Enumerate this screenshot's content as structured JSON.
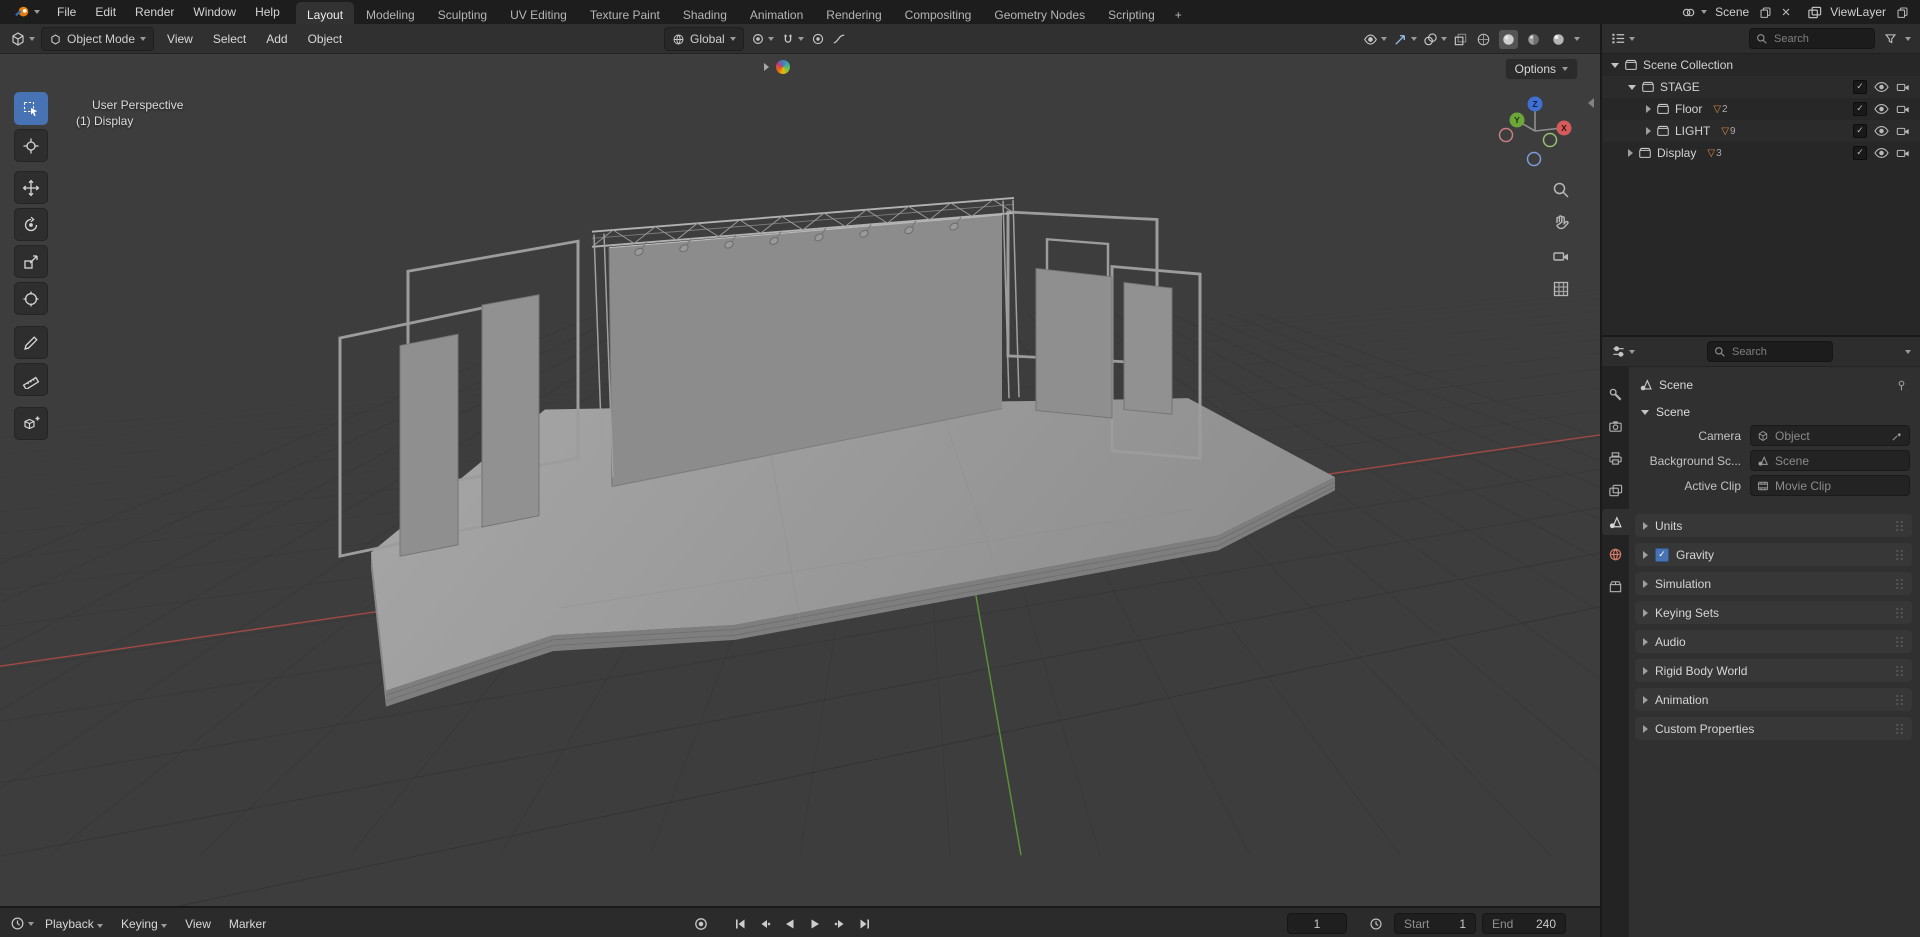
{
  "topbar": {
    "menus": [
      "File",
      "Edit",
      "Render",
      "Window",
      "Help"
    ],
    "tabs": [
      "Layout",
      "Modeling",
      "Sculpting",
      "UV Editing",
      "Texture Paint",
      "Shading",
      "Animation",
      "Rendering",
      "Compositing",
      "Geometry Nodes",
      "Scripting"
    ],
    "active_tab": "Layout",
    "new_workspace_label": "+",
    "scene_selector": {
      "value": "Scene"
    },
    "view_layer_selector": {
      "value": "ViewLayer"
    }
  },
  "viewport": {
    "header": {
      "mode": "Object Mode",
      "menus": [
        "View",
        "Select",
        "Add",
        "Object"
      ],
      "orientation": "Global"
    },
    "tool_header": {
      "options_label": "Options"
    },
    "overlay_text": {
      "line1": "User Perspective",
      "line2": "(1) Display"
    },
    "tools": [
      "Select Box",
      "Cursor",
      "Move",
      "Rotate",
      "Scale",
      "Transform",
      "Annotate",
      "Measure",
      "Add Cube"
    ],
    "axis_labels": {
      "x": "X",
      "y": "Y",
      "z": "Z"
    }
  },
  "outliner": {
    "search_placeholder": "Search",
    "badge_icon": "▽",
    "check_icon": "✓",
    "rows": [
      {
        "label": "Scene Collection"
      },
      {
        "label": "STAGE"
      },
      {
        "label": "Floor",
        "badge": "2"
      },
      {
        "label": "LIGHT",
        "badge": "9"
      },
      {
        "label": "Display",
        "badge": "3"
      }
    ]
  },
  "properties": {
    "search_placeholder": "Search",
    "breadcrumb": "Scene",
    "scene_section_label": "Scene",
    "camera_label": "Camera",
    "camera_value": "Object",
    "background_label": "Background Sc...",
    "background_value": "Scene",
    "active_clip_label": "Active Clip",
    "active_clip_value": "Movie Clip",
    "sections": [
      {
        "label": "Units"
      },
      {
        "label": "Gravity",
        "checked": true
      },
      {
        "label": "Simulation"
      },
      {
        "label": "Keying Sets"
      },
      {
        "label": "Audio"
      },
      {
        "label": "Rigid Body World"
      },
      {
        "label": "Animation"
      },
      {
        "label": "Custom Properties"
      }
    ]
  },
  "timeline": {
    "menus": [
      "Playback",
      "Keying",
      "View",
      "Marker"
    ],
    "current_frame": "1",
    "start_label": "Start",
    "start_value": "1",
    "end_label": "End",
    "end_value": "240"
  },
  "colors": {
    "accent": "#4772b3",
    "axis_x": "#aa4a44",
    "axis_y": "#5f9a35",
    "axis_z": "#3f6fd0"
  }
}
